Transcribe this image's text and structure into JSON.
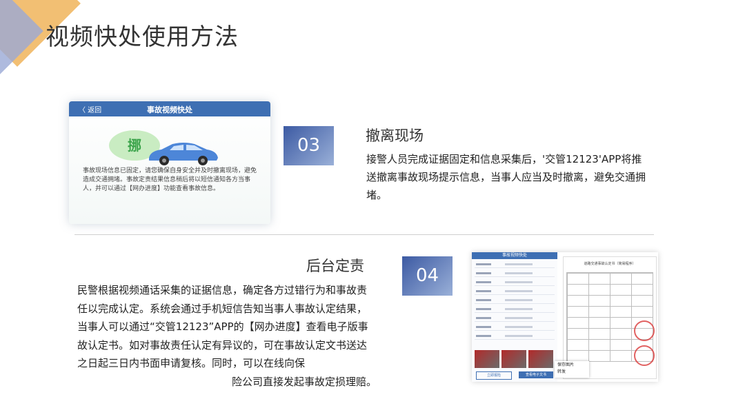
{
  "page": {
    "title": "视频快处使用方法"
  },
  "step03": {
    "number": "03",
    "heading": "撤离现场",
    "body": "接警人员完成证据固定和信息采集后，'交管12123'APP将推送撤离事故现场提示信息，当事人应当及时撤离，避免交通拥堵。",
    "screen": {
      "back": "〈 返回",
      "title": "事故视频快处",
      "bubble": "挪",
      "message": "事故现场信息已固定，请您确保自身安全并及时撤离现场，避免造成交通拥堵。事故定责结果信息稍后将以短信通知各方当事人，并可以通过【网办进度】功能查看事故信息。"
    }
  },
  "step04": {
    "number": "04",
    "heading": "后台定责",
    "body_lines": [
      "民警根据视频通话采集的证据信息，确定各方过错行为和事故责任以完成认定。系统会通过手机短信告知当事人事故认定结果，当事人可以通过“交管12123”APP的【网办进度】查看电子版事故认定书。如对事故责任认定有异议的，可在事故认定文书送达之日起三日内书面申请复核。同时，可以在线向保",
      "险公司直接发起事故定损理赔。"
    ],
    "screen": {
      "form_title": "事故视频快处",
      "doc_title": "道路交通事故认定书（简易程序）",
      "button1": "立即报险",
      "button2": "查看电子文书",
      "popup_items": [
        "保存图片",
        "转发"
      ]
    }
  },
  "colors": {
    "accent_blue": "#3e6fb3",
    "badge_start": "#3c5aa3",
    "badge_end": "#9ab0d8"
  }
}
